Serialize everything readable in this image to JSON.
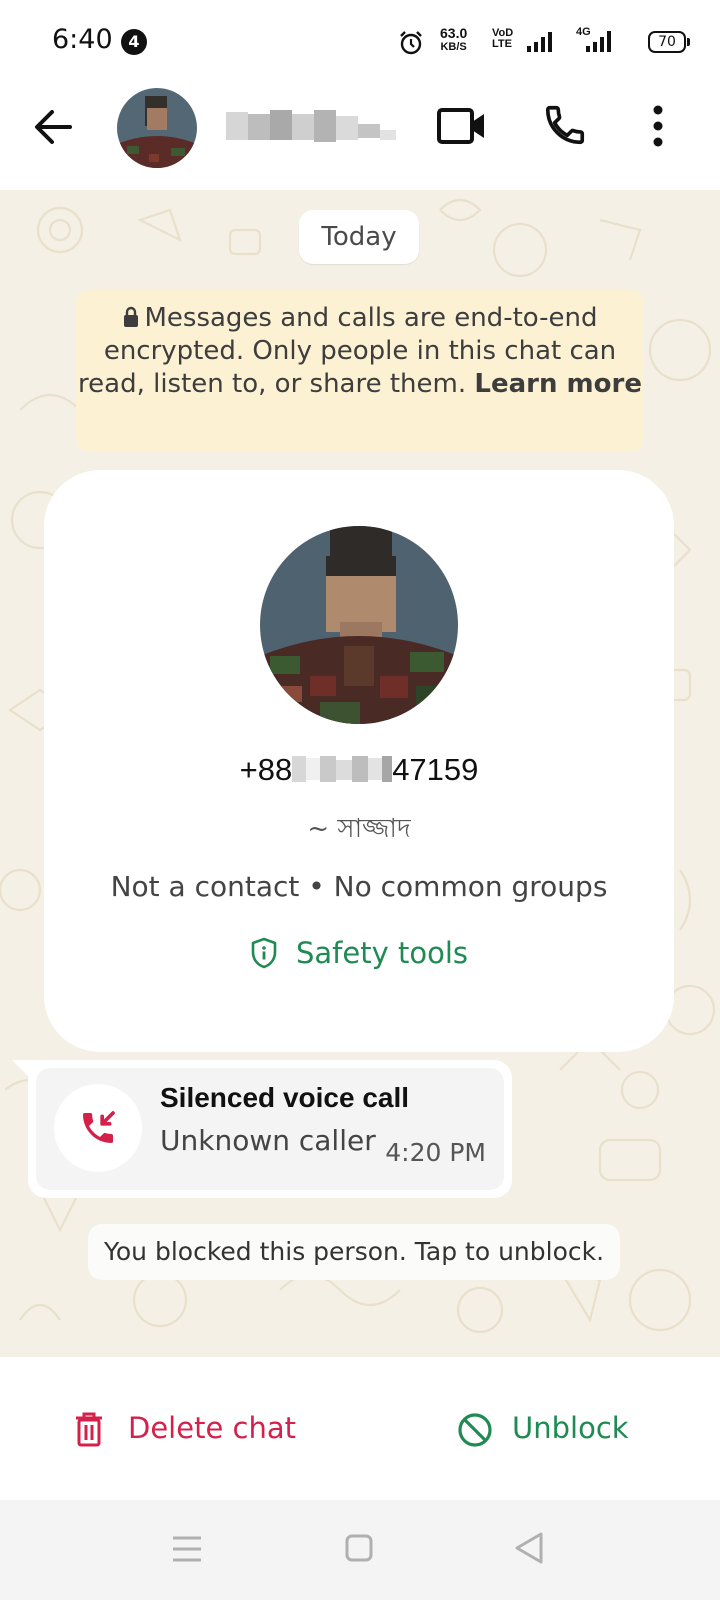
{
  "status_bar": {
    "time": "6:40",
    "notification_count": "4",
    "net_speed_value": "63.0",
    "net_speed_unit": "KB/S",
    "volte_label_1": "VoD",
    "volte_label_2": "LTE",
    "network_label": "4G",
    "battery": "70"
  },
  "header": {
    "contact_name": "",
    "back_icon": "arrow-left-icon",
    "video_icon": "video-camera-icon",
    "call_icon": "phone-icon",
    "menu_icon": "more-vert-icon"
  },
  "chat": {
    "date_chip": "Today",
    "e2e_notice": "Messages and calls are end-to-end encrypted. Only people in this chat can read, listen to, or share them.",
    "e2e_link": "Learn more",
    "profile": {
      "phone_prefix": "+88",
      "phone_suffix": "47159",
      "push_name": "~ সাজ্জাদ",
      "meta": "Not a contact • No common groups",
      "safety_tools": "Safety tools"
    },
    "call_message": {
      "title": "Silenced voice call",
      "subtitle": "Unknown caller",
      "time": "4:20 PM"
    },
    "blocked_notice": "You blocked this person. Tap to unblock."
  },
  "actions": {
    "delete_label": "Delete chat",
    "unblock_label": "Unblock"
  },
  "colors": {
    "accent_green": "#1f8a52",
    "danger_red": "#d4204a",
    "chat_bg": "#f5f0e5",
    "e2e_bg": "#fdf1d3"
  }
}
